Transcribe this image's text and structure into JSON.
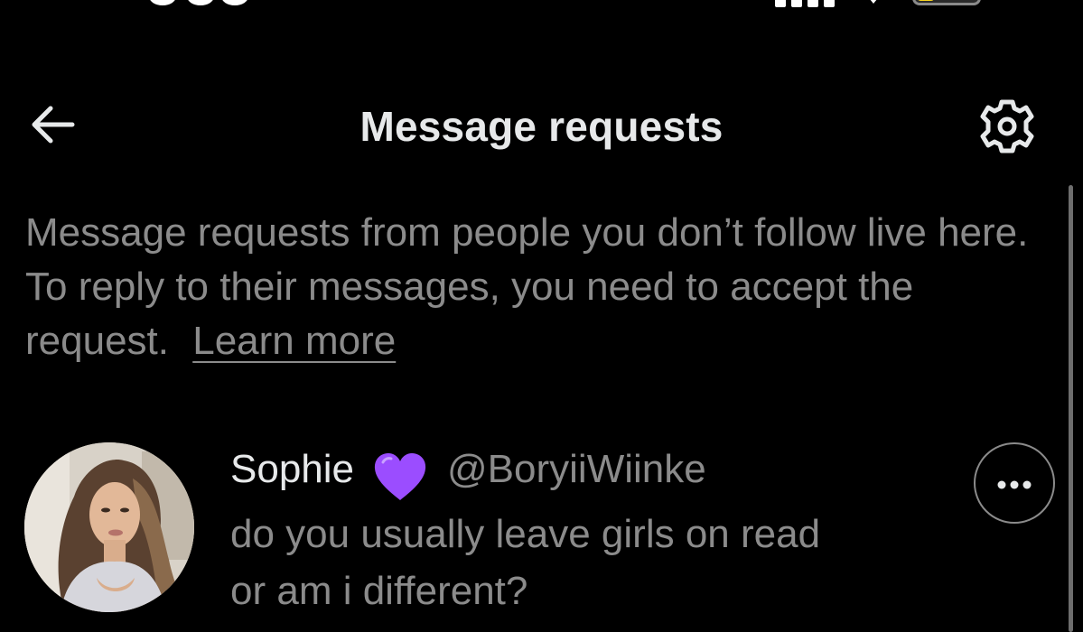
{
  "header": {
    "title": "Message requests",
    "back_icon": "arrow-left-icon",
    "settings_icon": "gear-icon"
  },
  "info": {
    "text": "Message requests from people you don’t follow live here. To reply to their messages, you need to accept the request.",
    "link_label": "Learn more"
  },
  "requests": [
    {
      "name": "Sophie",
      "emoji": "purple-heart",
      "handle": "@BoryiiWiinke",
      "preview_line1": "do you usually leave girls on read",
      "preview_line2": "or am i different?",
      "more_icon": "more-horizontal-icon"
    }
  ],
  "colors": {
    "background": "#000000",
    "primary_text": "#e7e9ea",
    "secondary_text": "#8b8b8b",
    "heart": "#9b4dff",
    "battery_fill": "#f7d31e"
  }
}
